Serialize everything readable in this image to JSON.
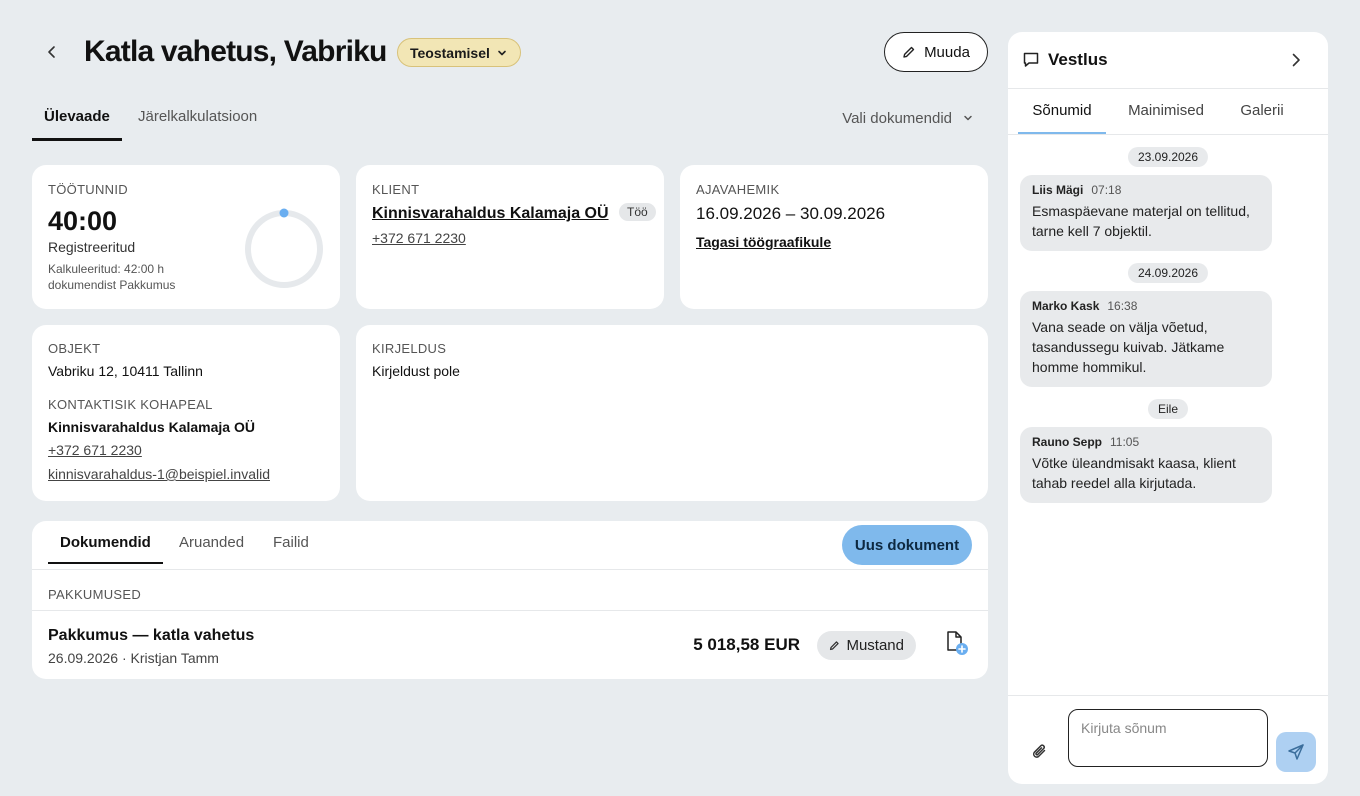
{
  "header": {
    "title": "Katla vahetus, Vabriku",
    "status": "Teostamisel",
    "edit_label": "Muuda"
  },
  "tabs": [
    {
      "label": "Ülevaade",
      "active": true
    },
    {
      "label": "Järelkalkulatsioon",
      "active": false
    }
  ],
  "doc_select_label": "Vali dokumendid",
  "hours_card": {
    "label": "Töötunnid",
    "value": "40:00",
    "caption": "Registreeritud",
    "calc_line1": "Kalkuleeritud: 42:00 h",
    "calc_line2": "dokumendist Pakkumus"
  },
  "client_card": {
    "label": "Klient",
    "name": "Kinnisvarahaldus Kalamaja OÜ",
    "badge": "Töö",
    "phone": "+372 671 2230"
  },
  "period_card": {
    "label": "Ajavahemik",
    "range": "16.09.2026 – 30.09.2026",
    "link": "Tagasi töögraafikule"
  },
  "object_card": {
    "label": "Objekt",
    "address": "Vabriku 12, 10411 Tallinn",
    "contact_label": "Kontaktisik kohapeal",
    "contact_name": "Kinnisvarahaldus Kalamaja OÜ",
    "contact_phone": "+372 671 2230",
    "contact_email": "kinnisvarahaldus-1@beispiel.invalid"
  },
  "description_card": {
    "label": "Kirjeldus",
    "text": "Kirjeldust pole"
  },
  "documents": {
    "tabs": [
      {
        "label": "Dokumendid",
        "active": true
      },
      {
        "label": "Aruanded",
        "active": false
      },
      {
        "label": "Failid",
        "active": false
      }
    ],
    "new_label": "Uus dokument",
    "section_label": "Pakkumused",
    "items": [
      {
        "name": "Pakkumus — katla vahetus",
        "meta": "26.09.2026 · Kristjan Tamm",
        "amount": "5 018,58 EUR",
        "status": "Mustand"
      }
    ]
  },
  "chat": {
    "title": "Vestlus",
    "tabs": [
      {
        "label": "Sõnumid",
        "active": true
      },
      {
        "label": "Mainimised",
        "active": false
      },
      {
        "label": "Galerii",
        "active": false
      }
    ],
    "dates": [
      "23.09.2026",
      "24.09.2026",
      "Eile"
    ],
    "messages": [
      {
        "author": "Liis Mägi",
        "time": "07:18",
        "text": "Esmaspäevane materjal on tellitud, tarne kell 7 objektil."
      },
      {
        "author": "Marko Kask",
        "time": "16:38",
        "text": "Vana seade on välja võetud, tasandussegu kuivab. Jätkame homme hommikul."
      },
      {
        "author": "Rauno Sepp",
        "time": "11:05",
        "text": "Võtke üleandmisakt kaasa, klient tahab reedel alla kirjutada."
      }
    ],
    "input_placeholder": "Kirjuta sõnum"
  },
  "colors": {
    "background": "#e8ecef",
    "status_pill": "#f2e6b5",
    "accent": "#7fb9ec",
    "progress_dot": "#6aaef0"
  },
  "hours_progress": 0.0
}
